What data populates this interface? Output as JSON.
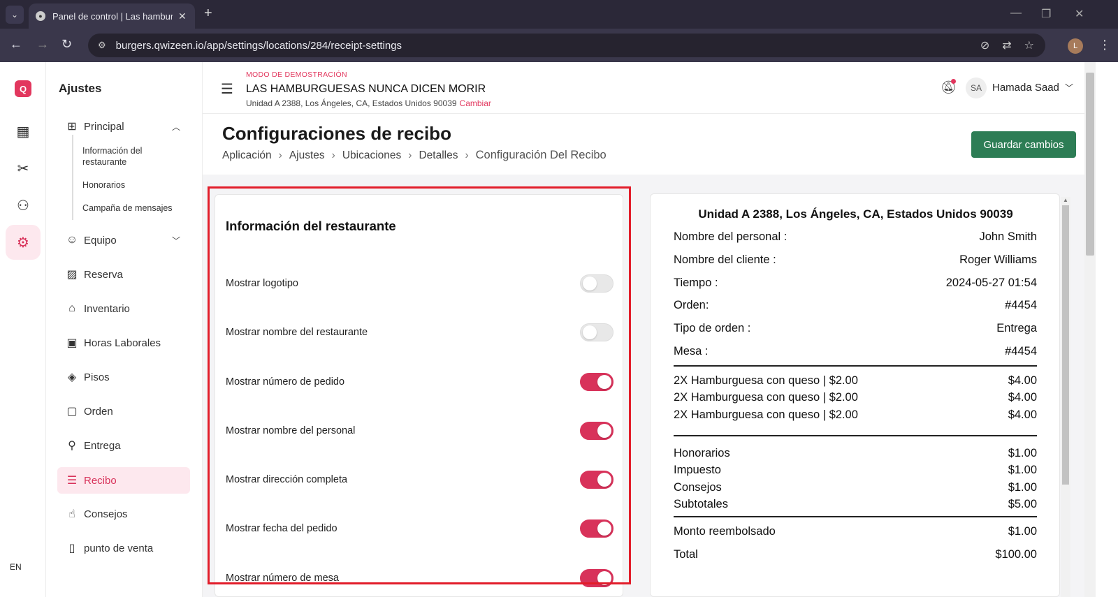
{
  "browser": {
    "tab_title": "Panel de control | Las hamburguesas",
    "url": "burgers.qwizeen.io/app/settings/locations/284/receipt-settings",
    "profile_initial": "L"
  },
  "rail": {
    "logo": "Q",
    "icons": [
      "dashboard-icon",
      "utensils-icon",
      "sitemap-icon",
      "gear-icon"
    ],
    "lang": "EN"
  },
  "settings_nav": {
    "title": "Ajustes",
    "principal": "Principal",
    "sub_items": [
      "Información del restaurante",
      "Honorarios",
      "Campaña de mensajes"
    ],
    "items": [
      {
        "label": "Equipo"
      },
      {
        "label": "Reserva"
      },
      {
        "label": "Inventario"
      },
      {
        "label": "Horas Laborales"
      },
      {
        "label": "Pisos"
      },
      {
        "label": "Orden"
      },
      {
        "label": "Entrega"
      },
      {
        "label": "Recibo"
      },
      {
        "label": "Consejos"
      },
      {
        "label": "punto de venta"
      }
    ]
  },
  "header": {
    "demo_mode": "MODO DE DEMOSTRACIÓN",
    "restaurant_name": "LAS HAMBURGUESAS NUNCA DICEN MORIR",
    "address": "Unidad A 2388, Los Ángeles, CA, Estados Unidos 90039",
    "change": "Cambiar",
    "avatar": "SA",
    "user_name": "Hamada Saad"
  },
  "page": {
    "title": "Configuraciones de recibo",
    "breadcrumb": [
      "Aplicación",
      "Ajustes",
      "Ubicaciones",
      "Detalles",
      "Configuración Del Recibo"
    ],
    "save": "Guardar cambios"
  },
  "settings_card": {
    "title": "Información del restaurante",
    "toggles": [
      {
        "label": "Mostrar logotipo",
        "on": false
      },
      {
        "label": "Mostrar nombre del restaurante",
        "on": false
      },
      {
        "label": "Mostrar número de pedido",
        "on": true
      },
      {
        "label": "Mostrar nombre del personal",
        "on": true
      },
      {
        "label": "Mostrar dirección completa",
        "on": true
      },
      {
        "label": "Mostrar fecha del pedido",
        "on": true
      },
      {
        "label": "Mostrar número de mesa",
        "on": true
      }
    ]
  },
  "receipt": {
    "address": "Unidad A 2388, Los Ángeles, CA, Estados Unidos 90039",
    "info": [
      {
        "label": "Nombre del personal :",
        "value": "John Smith"
      },
      {
        "label": "Nombre del cliente :",
        "value": "Roger Williams"
      },
      {
        "label": "Tiempo :",
        "value": "2024-05-27 01:54"
      },
      {
        "label": "Orden:",
        "value": "#4454"
      },
      {
        "label": "Tipo de orden :",
        "value": "Entrega"
      },
      {
        "label": "Mesa :",
        "value": "#4454"
      }
    ],
    "items": [
      {
        "label": "2X Hamburguesa con queso | $2.00",
        "value": "$4.00"
      },
      {
        "label": "2X Hamburguesa con queso | $2.00",
        "value": "$4.00"
      },
      {
        "label": "2X Hamburguesa con queso | $2.00",
        "value": "$4.00"
      }
    ],
    "totals": [
      {
        "label": "Honorarios",
        "value": "$1.00"
      },
      {
        "label": "Impuesto",
        "value": "$1.00"
      },
      {
        "label": "Consejos",
        "value": "$1.00"
      },
      {
        "label": "Subtotales",
        "value": "$5.00"
      }
    ],
    "refund": {
      "label": "Monto reembolsado",
      "value": "$1.00"
    },
    "total": {
      "label": "Total",
      "value": "$100.00"
    }
  }
}
